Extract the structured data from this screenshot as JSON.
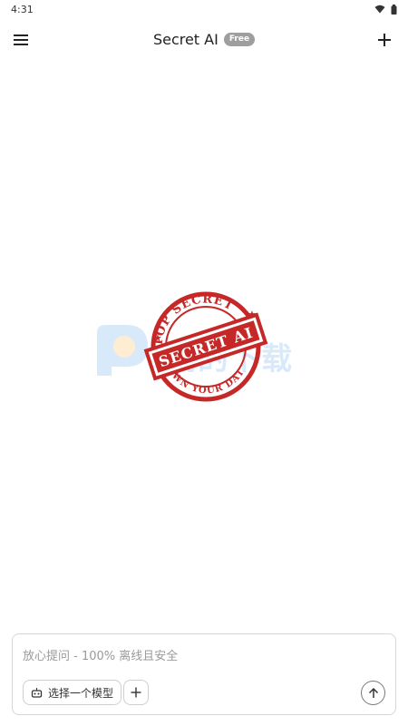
{
  "status_bar": {
    "time": "4:31",
    "icons": [
      "wifi-icon",
      "battery-icon"
    ]
  },
  "app_bar": {
    "title": "Secret AI",
    "badge": "Free",
    "left_icon": "menu-icon",
    "right_icon": "plus-icon"
  },
  "logo": {
    "stamp_top_text": "TOP SECRET",
    "stamp_center_text": "SECRET AI",
    "stamp_bottom_text": "OWN YOUR DATA",
    "watermark_text": "高的下载",
    "stamp_color": "#c62828",
    "watermark_color": "#1e88e5"
  },
  "composer": {
    "placeholder": "放心提问 - 100% 离线且安全",
    "model_button_label": "选择一个模型",
    "model_icon": "robot-icon",
    "attach_icon": "plus-icon",
    "send_icon": "arrow-up-icon"
  },
  "colors": {
    "background": "#ffffff",
    "badge_bg": "#9e9e9e",
    "border": "#d6d6d6"
  }
}
